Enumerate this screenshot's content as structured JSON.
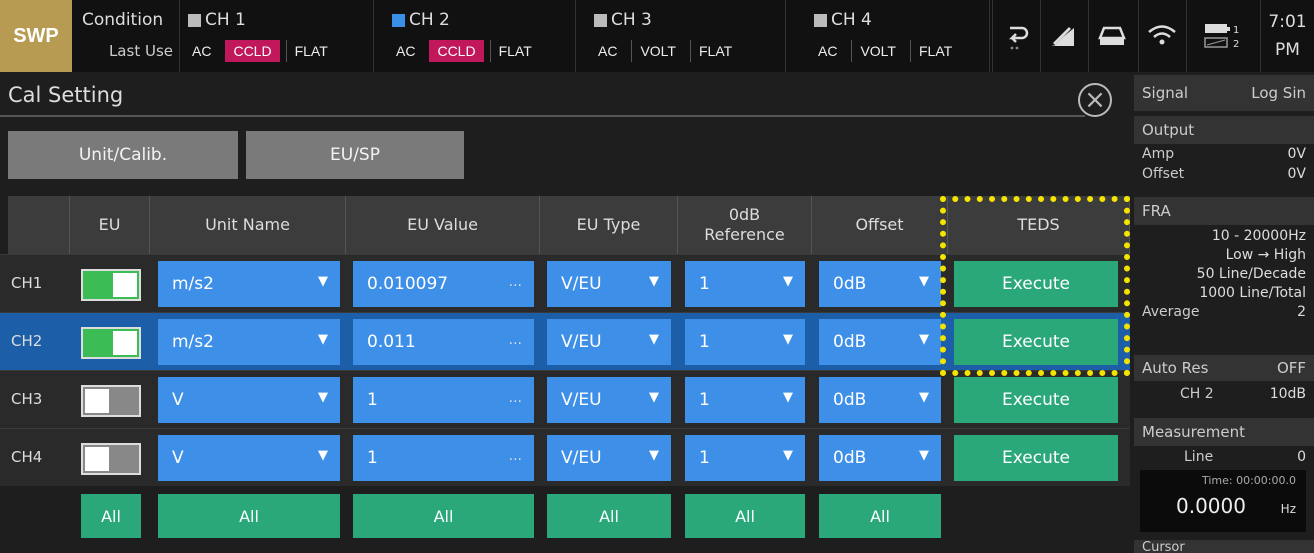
{
  "topbar": {
    "mode": "SWP",
    "condition": "Condition",
    "last_use": "Last Use",
    "channels": [
      {
        "name": "CH 1",
        "tags": [
          "AC",
          "CCLD",
          "FLAT"
        ]
      },
      {
        "name": "CH 2",
        "tags": [
          "AC",
          "CCLD",
          "FLAT"
        ]
      },
      {
        "name": "CH 3",
        "tags": [
          "AC",
          "VOLT",
          "FLAT"
        ]
      },
      {
        "name": "CH 4",
        "tags": [
          "AC",
          "VOLT",
          "FLAT"
        ]
      }
    ],
    "icons": [
      "return-icon",
      "chart-icon",
      "drive-icon",
      "wifi-icon",
      "battery-icon"
    ],
    "battery_labels": [
      "1",
      "2"
    ],
    "time": "7:01",
    "ampm": "PM"
  },
  "page": {
    "title": "Cal Setting",
    "subtabs": [
      "Unit/Calib.",
      "EU/SP"
    ]
  },
  "table": {
    "headers": [
      "EU",
      "Unit Name",
      "EU Value",
      "EU Type",
      "0dB\nReference",
      "Offset",
      "TEDS"
    ],
    "rows": [
      {
        "ch": "CH1",
        "eu_on": true,
        "unit": "m/s2",
        "eu_value": "0.010097",
        "eu_type": "V/EU",
        "ref": "1",
        "offset": "0dB",
        "teds": "Execute"
      },
      {
        "ch": "CH2",
        "eu_on": true,
        "unit": "m/s2",
        "eu_value": "0.011",
        "eu_type": "V/EU",
        "ref": "1",
        "offset": "0dB",
        "teds": "Execute"
      },
      {
        "ch": "CH3",
        "eu_on": false,
        "unit": "V",
        "eu_value": "1",
        "eu_type": "V/EU",
        "ref": "1",
        "offset": "0dB",
        "teds": "Execute"
      },
      {
        "ch": "CH4",
        "eu_on": false,
        "unit": "V",
        "eu_value": "1",
        "eu_type": "V/EU",
        "ref": "1",
        "offset": "0dB",
        "teds": "Execute"
      }
    ],
    "all_label": "All",
    "dots": "...",
    "arrow": "▼"
  },
  "sidebar": {
    "signal_label": "Signal",
    "signal_value": "Log Sin",
    "output_label": "Output",
    "amp_label": "Amp",
    "amp_value": "0V",
    "offset_label": "Offset",
    "offset_value": "0V",
    "fra_label": "FRA",
    "fra_range": "10 -  20000Hz",
    "fra_dir": "Low → High",
    "fra_lines_decade": "50 Line/Decade",
    "fra_lines_total": "1000 Line/Total",
    "average_label": "Average",
    "average_value": "2",
    "autores_label": "Auto Res",
    "autores_value": "OFF",
    "autores_ch": "CH 2",
    "autores_db": "10dB",
    "measurement_label": "Measurement",
    "line_label": "Line",
    "line_value": "0",
    "time_label": "Time: 00:00:00.0",
    "meas_value": "0.0000",
    "meas_unit": "Hz",
    "cursor_label": "Cursor"
  }
}
